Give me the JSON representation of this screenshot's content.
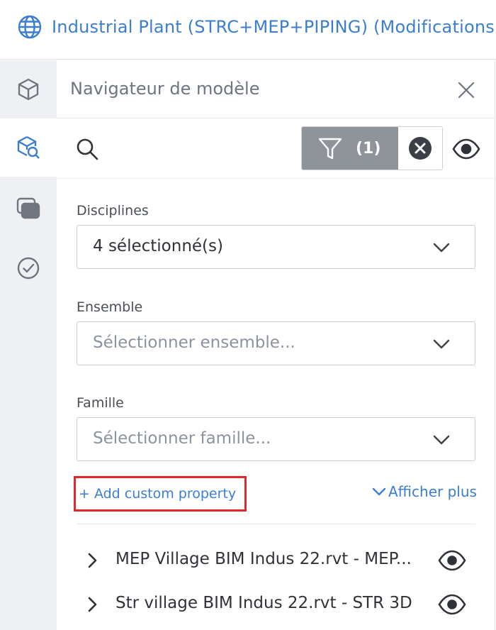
{
  "header": {
    "icon": "globe-icon",
    "title": "Industrial Plant (STRC+MEP+PIPING) (Modifications no",
    "accent_color": "#3b7ed1"
  },
  "siderail": {
    "items": [
      {
        "icon": "cube-icon",
        "active": false
      },
      {
        "icon": "model-browser-icon",
        "active": true
      },
      {
        "icon": "layers-icon",
        "active": false
      },
      {
        "icon": "check-circle-icon",
        "active": false
      }
    ]
  },
  "panel": {
    "title": "Navigateur de modèle",
    "close_icon": "close-icon"
  },
  "toolbar": {
    "search_icon": "search-icon",
    "filter_icon": "funnel-icon",
    "filter_count": "(1)",
    "clear_icon": "clear-filter-icon",
    "visibility_icon": "eye-icon"
  },
  "filters": {
    "disciplines": {
      "label": "Disciplines",
      "value": "4 sélectionné(s)"
    },
    "ensemble": {
      "label": "Ensemble",
      "placeholder": "Sélectionner ensemble..."
    },
    "famille": {
      "label": "Famille",
      "placeholder": "Sélectionner famille..."
    }
  },
  "actions": {
    "add_custom_property": "+ Add custom property",
    "show_more": "Afficher plus",
    "highlight_color": "#e02a2a"
  },
  "models": [
    {
      "name": "MEP Village BIM Indus 22.rvt - MEP...",
      "visible": true
    },
    {
      "name": "Str village BIM Indus 22.rvt - STR 3D",
      "visible": true
    }
  ]
}
